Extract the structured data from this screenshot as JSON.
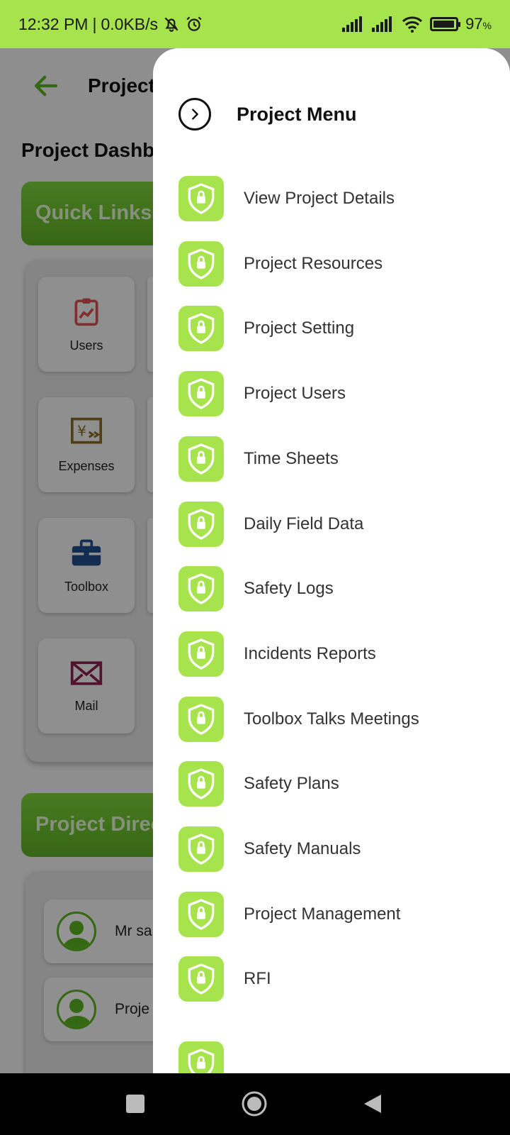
{
  "status_bar": {
    "time": "12:32 PM",
    "speed": "0.0KB/s",
    "battery_pct": "97",
    "battery_unit": "%",
    "battery_level": 0.97,
    "icons": [
      "mute-bell-icon",
      "alarm-icon",
      "signal-icon",
      "signal-icon",
      "wifi-icon",
      "battery-icon"
    ]
  },
  "background": {
    "header_title": "Project",
    "dashboard_title": "Project Dashb",
    "quick_links_title": "Quick Links",
    "quick_links": [
      {
        "label": "Users",
        "icon": "clipboard-chart-icon",
        "color": "#d9534f"
      },
      {
        "label": "Expenses",
        "icon": "yen-transfer-icon",
        "color": "#8a6d1f"
      },
      {
        "label": "Toolbox",
        "icon": "toolbox-icon",
        "color": "#1f4e8a"
      },
      {
        "label": "Mail",
        "icon": "mail-icon",
        "color": "#8a1f4e"
      }
    ],
    "directory_title": "Project Direc",
    "directory_rows": [
      {
        "name": "Mr sa"
      },
      {
        "name": "Proje"
      }
    ]
  },
  "drawer": {
    "title": "Project Menu",
    "items": [
      {
        "label": "View Project Details"
      },
      {
        "label": "Project Resources"
      },
      {
        "label": "Project Setting"
      },
      {
        "label": "Project Users"
      },
      {
        "label": "Time Sheets"
      },
      {
        "label": "Daily Field Data"
      },
      {
        "label": "Safety Logs"
      },
      {
        "label": "Incidents Reports"
      },
      {
        "label": "Toolbox Talks Meetings"
      },
      {
        "label": "Safety Plans"
      },
      {
        "label": "Safety Manuals"
      },
      {
        "label": "Project Management"
      },
      {
        "label": "RFI"
      }
    ],
    "accent_color": "#a6e34c"
  },
  "nav_bar": {
    "buttons": [
      "recents-button",
      "home-button",
      "back-button"
    ]
  }
}
